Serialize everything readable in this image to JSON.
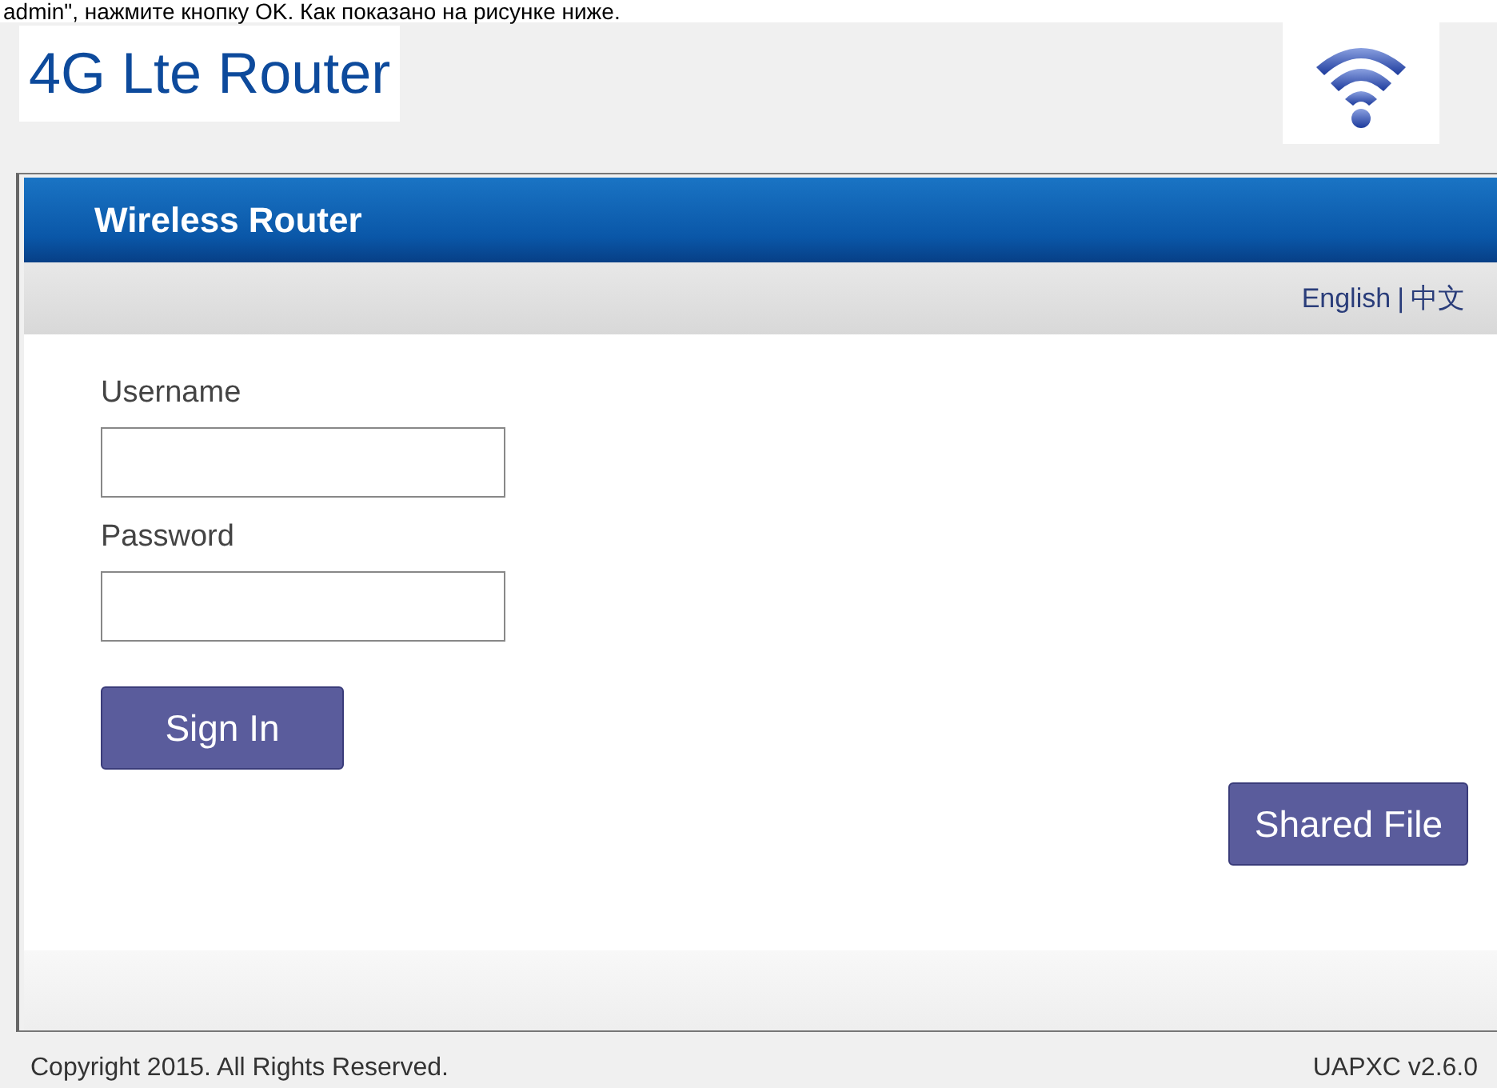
{
  "caption": "admin\", нажмите кнопку OK. Как показано на рисунке ниже.",
  "logo": {
    "title": "4G Lte Router"
  },
  "panel": {
    "title": "Wireless Router"
  },
  "languages": {
    "items": [
      "English",
      "中文"
    ],
    "separator": "|"
  },
  "form": {
    "fields": [
      {
        "label": "Username"
      },
      {
        "label": "Password"
      }
    ],
    "submit": "Sign In"
  },
  "shared_button": "Shared File",
  "footer": {
    "copyright": "Copyright 2015. All Rights Reserved.",
    "version": "UAPXC v2.6.0"
  }
}
